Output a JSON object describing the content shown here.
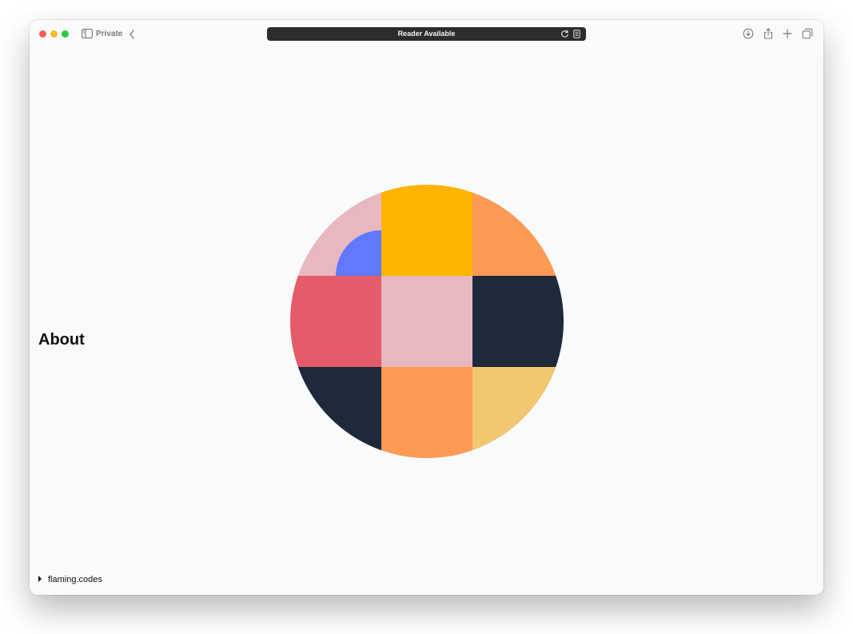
{
  "browser": {
    "private_label": "Private",
    "address_text": "Reader Available",
    "icons": {
      "sidebar": "sidebar-icon",
      "back": "chevron-left-icon",
      "reload": "reload-icon",
      "reader": "reader-icon",
      "download": "download-icon",
      "share": "share-icon",
      "new_tab": "plus-icon",
      "tabs": "tabs-overview-icon"
    }
  },
  "page": {
    "heading": "About",
    "footer_link": "flaming.codes"
  },
  "artwork": {
    "cells": [
      {
        "row": 0,
        "col": 0,
        "color": "#e8b7c0"
      },
      {
        "row": 0,
        "col": 1,
        "color": "#fdb302"
      },
      {
        "row": 0,
        "col": 2,
        "color": "#fe9a55"
      },
      {
        "row": 1,
        "col": 0,
        "color": "#e45c6b"
      },
      {
        "row": 1,
        "col": 1,
        "color": "#e8b7c0"
      },
      {
        "row": 1,
        "col": 2,
        "color": "#1e293b"
      },
      {
        "row": 2,
        "col": 0,
        "color": "#1e293b"
      },
      {
        "row": 2,
        "col": 1,
        "color": "#fe9a55"
      },
      {
        "row": 2,
        "col": 2,
        "color": "#f2c771"
      }
    ],
    "accent_quarter_circle": "#6079fe"
  }
}
